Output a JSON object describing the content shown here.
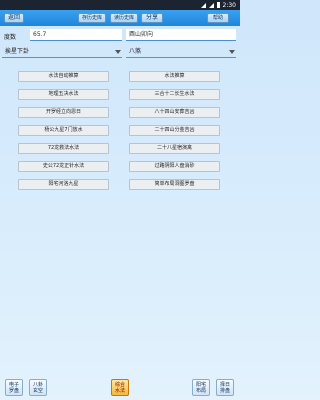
{
  "status": {
    "time": "2:30"
  },
  "top_bar": {
    "back_label": "返回",
    "btn1_label": "存历史库",
    "btn2_label": "读历史库",
    "share_label": "分享",
    "help_label": "帮助"
  },
  "inputs": {
    "degree_label": "度数",
    "degree_value": "65.7",
    "direction_value": "酉山卯向"
  },
  "selects": {
    "gua_value": "挨星下卦",
    "sha_value": "八煞"
  },
  "buttons": [
    {
      "left": "水法自动推算",
      "right": "水法推算"
    },
    {
      "left": "地理五决水法",
      "right": "三合十二长生水法"
    },
    {
      "left": "开罗经立向恩日",
      "right": "八十四山安葬吉凶"
    },
    {
      "left": "杨公九星7门放水",
      "right": "二十四山分金吉凶"
    },
    {
      "left": "72龙救法水法",
      "right": "二十八星宿演禽"
    },
    {
      "left": "史公72龙正针水法",
      "right": "过路阴阳人盘消砂"
    },
    {
      "left": "阳宅河洛九星",
      "right": "简单布局洞图罗盘"
    }
  ],
  "bottom_bar": [
    {
      "label1": "电子",
      "label2": "罗盘"
    },
    {
      "label1": "八卦",
      "label2": "玄空"
    },
    {
      "label1": "综合",
      "label2": "水法"
    },
    {
      "label1": "阳宅",
      "label2": "布局"
    },
    {
      "label1": "择日",
      "label2": "排盘"
    }
  ]
}
